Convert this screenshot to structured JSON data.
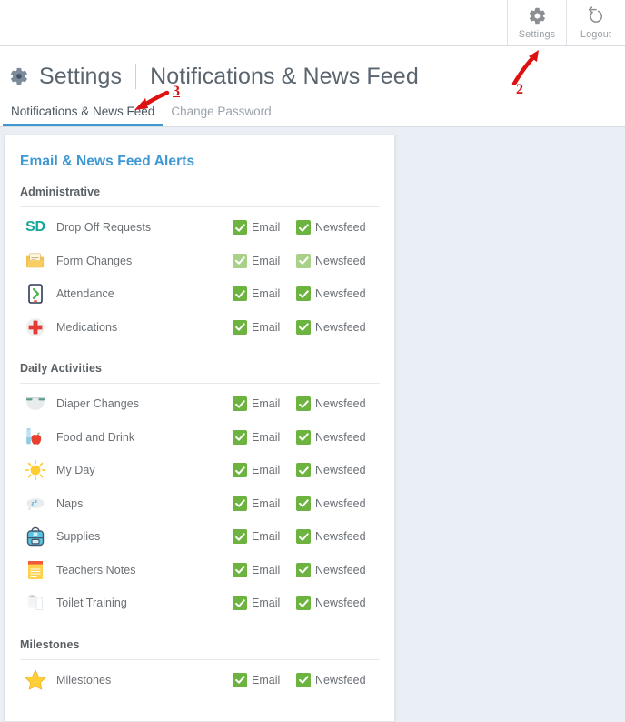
{
  "topbar": {
    "buttons": [
      {
        "label": "Settings",
        "icon": "gear-icon"
      },
      {
        "label": "Logout",
        "icon": "logout-icon"
      }
    ]
  },
  "header": {
    "gear_icon": "gear-icon",
    "title": "Settings",
    "separator": "|",
    "subtitle": "Notifications & News Feed"
  },
  "tabs": [
    {
      "label": "Notifications & News Feed",
      "active": true
    },
    {
      "label": "Change Password",
      "active": false
    }
  ],
  "card": {
    "title": "Email & News Feed Alerts",
    "email_label": "Email",
    "newsfeed_label": "Newsfeed",
    "sections": [
      {
        "title": "Administrative",
        "rows": [
          {
            "label": "Drop Off Requests",
            "icon": "sd-logo-icon",
            "email": true,
            "newsfeed": true,
            "faded": false
          },
          {
            "label": "Form Changes",
            "icon": "folder-icon",
            "email": true,
            "newsfeed": true,
            "faded": true
          },
          {
            "label": "Attendance",
            "icon": "phone-checkin-icon",
            "email": true,
            "newsfeed": true,
            "faded": false
          },
          {
            "label": "Medications",
            "icon": "medical-cross-icon",
            "email": true,
            "newsfeed": true,
            "faded": false
          }
        ]
      },
      {
        "title": "Daily Activities",
        "rows": [
          {
            "label": "Diaper Changes",
            "icon": "diaper-icon",
            "email": true,
            "newsfeed": true,
            "faded": false
          },
          {
            "label": "Food and Drink",
            "icon": "bottle-apple-icon",
            "email": true,
            "newsfeed": true,
            "faded": false
          },
          {
            "label": "My Day",
            "icon": "sun-icon",
            "email": true,
            "newsfeed": true,
            "faded": false
          },
          {
            "label": "Naps",
            "icon": "sleep-cloud-icon",
            "email": true,
            "newsfeed": true,
            "faded": false
          },
          {
            "label": "Supplies",
            "icon": "backpack-icon",
            "email": true,
            "newsfeed": true,
            "faded": false
          },
          {
            "label": "Teachers Notes",
            "icon": "notepad-icon",
            "email": true,
            "newsfeed": true,
            "faded": false
          },
          {
            "label": "Toilet Training",
            "icon": "toilet-paper-icon",
            "email": true,
            "newsfeed": true,
            "faded": false
          }
        ]
      },
      {
        "title": "Milestones",
        "rows": [
          {
            "label": "Milestones",
            "icon": "star-icon",
            "email": true,
            "newsfeed": true,
            "faded": false
          }
        ]
      }
    ]
  },
  "annotations": [
    {
      "number": "2",
      "target": "settings-button"
    },
    {
      "number": "3",
      "target": "notifications-tab"
    }
  ],
  "colors": {
    "accent_blue": "#3c97d3",
    "checkbox_green": "#6cb33f",
    "checkbox_green_faded": "#a9d189",
    "annotation_red": "#dd1111",
    "page_background": "#eaeef5"
  }
}
